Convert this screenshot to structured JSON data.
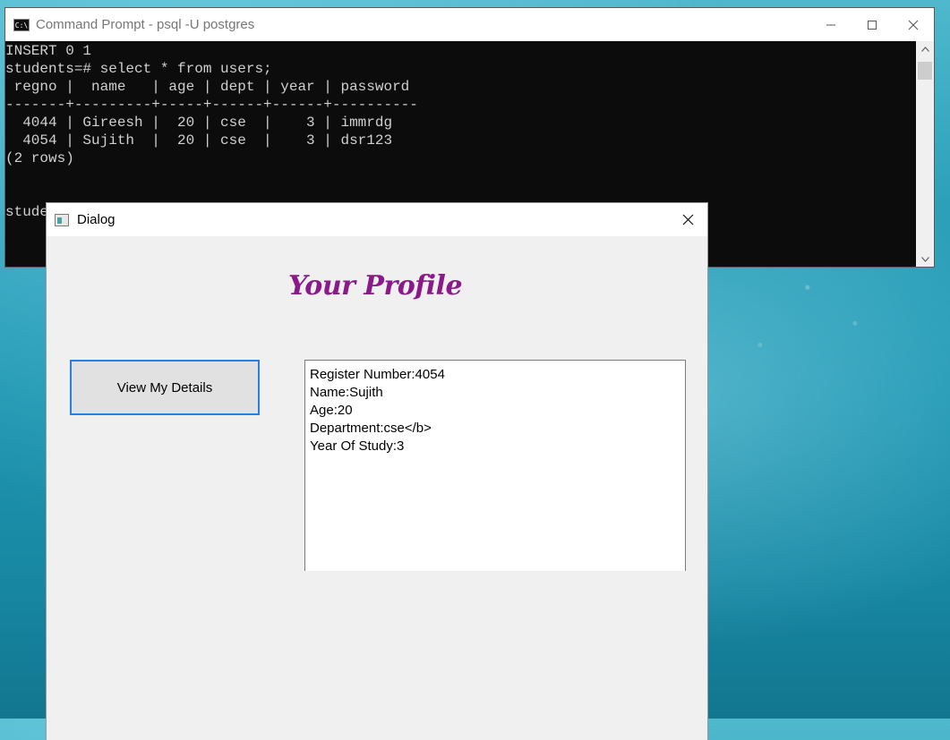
{
  "cmd": {
    "title": "Command Prompt - psql  -U postgres",
    "icon_label": "C:\\",
    "lines": [
      "INSERT 0 1",
      "students=# select * from users;",
      " regno |  name   | age | dept | year | password",
      "-------+---------+-----+------+------+----------",
      "  4044 | Gireesh |  20 | cse  |    3 | immrdg",
      "  4054 | Sujith  |  20 | cse  |    3 | dsr123",
      "(2 rows)",
      "",
      "",
      "stude"
    ]
  },
  "dialog": {
    "title": "Dialog",
    "heading": "Your Profile",
    "button_label": "View My Details",
    "details": [
      "Register Number:4054",
      "Name:Sujith",
      "Age:20",
      "Department:cse</b>",
      "Year Of Study:3"
    ]
  },
  "icons": {
    "minimize": "minimize-icon",
    "maximize": "maximize-icon",
    "close": "close-icon"
  },
  "colors": {
    "heading": "#8a1a8a",
    "button_border": "#2b7de0",
    "terminal_bg": "#0c0c0c"
  }
}
